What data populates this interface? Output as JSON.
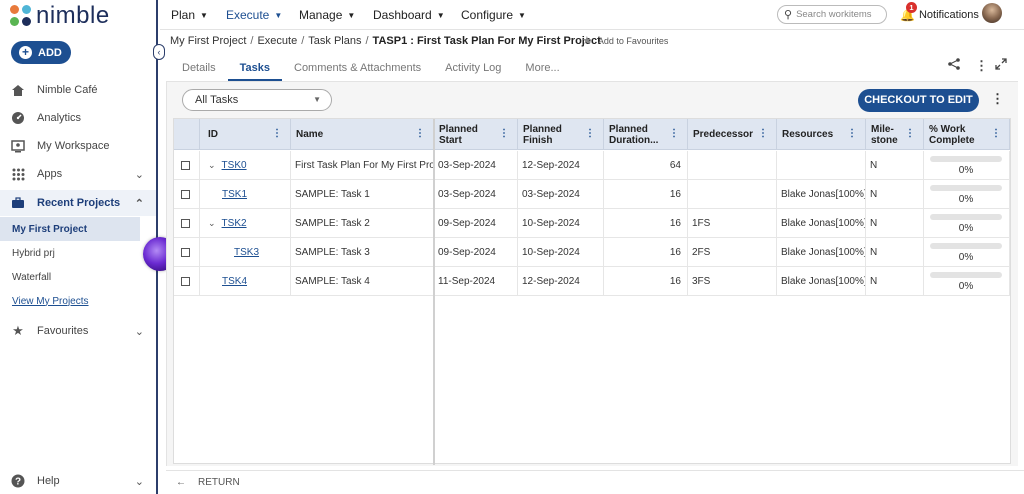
{
  "brand": {
    "name": "nimble"
  },
  "sidebar": {
    "add_label": "ADD",
    "items": [
      {
        "label": "Nimble Café",
        "icon": "home-icon"
      },
      {
        "label": "Analytics",
        "icon": "speedometer-icon"
      },
      {
        "label": "My Workspace",
        "icon": "workspace-icon"
      },
      {
        "label": "Apps",
        "icon": "apps-grid-icon"
      },
      {
        "label": "Recent Projects",
        "icon": "briefcase-icon"
      },
      {
        "label": "Favourites",
        "icon": "star-icon"
      },
      {
        "label": "Help",
        "icon": "help-icon"
      }
    ],
    "recent_projects": [
      "My First Project",
      "Hybrid prj",
      "Waterfall"
    ],
    "view_projects_label": "View My Projects"
  },
  "topnav": {
    "menus": [
      "Plan",
      "Execute",
      "Manage",
      "Dashboard",
      "Configure"
    ],
    "active_menu": "Execute",
    "search_placeholder": "Search workitems",
    "notifications_label": "Notifications",
    "notification_count": "1"
  },
  "breadcrumb": {
    "items": [
      "My First Project",
      "Execute",
      "Task Plans"
    ],
    "current": "TASP1 : First Task Plan For My First Project",
    "favourite_label": "Add to Favourites"
  },
  "tabs": [
    "Details",
    "Tasks",
    "Comments & Attachments",
    "Activity Log",
    "More..."
  ],
  "active_tab": "Tasks",
  "toolbar": {
    "filter_value": "All Tasks",
    "checkout_label": "CHECKOUT TO EDIT"
  },
  "grid": {
    "columns": [
      "ID",
      "Name",
      "Planned Start",
      "Planned Finish",
      "Planned Duration...",
      "Predecessor",
      "Resources",
      "Mile-stone",
      "% Work Complete"
    ],
    "rows": [
      {
        "id": "TSK0",
        "expand": true,
        "indent": 0,
        "name": "First Task Plan For My First Project",
        "start": "03-Sep-2024",
        "finish": "12-Sep-2024",
        "duration": "64",
        "predecessor": "",
        "resources": "",
        "milestone": "N",
        "progress": "0%"
      },
      {
        "id": "TSK1",
        "expand": false,
        "indent": 1,
        "name": "SAMPLE: Task 1",
        "start": "03-Sep-2024",
        "finish": "03-Sep-2024",
        "duration": "16",
        "predecessor": "",
        "resources": "Blake Jonas[100%]",
        "milestone": "N",
        "progress": "0%"
      },
      {
        "id": "TSK2",
        "expand": true,
        "indent": 0,
        "name": "SAMPLE: Task 2",
        "start": "09-Sep-2024",
        "finish": "10-Sep-2024",
        "duration": "16",
        "predecessor": "1FS",
        "resources": "Blake Jonas[100%]",
        "milestone": "N",
        "progress": "0%"
      },
      {
        "id": "TSK3",
        "expand": false,
        "indent": 2,
        "name": "SAMPLE: Task 3",
        "start": "09-Sep-2024",
        "finish": "10-Sep-2024",
        "duration": "16",
        "predecessor": "2FS",
        "resources": "Blake Jonas[100%]",
        "milestone": "N",
        "progress": "0%"
      },
      {
        "id": "TSK4",
        "expand": false,
        "indent": 1,
        "name": "SAMPLE: Task 4",
        "start": "11-Sep-2024",
        "finish": "12-Sep-2024",
        "duration": "16",
        "predecessor": "3FS",
        "resources": "Blake Jonas[100%]",
        "milestone": "N",
        "progress": "0%"
      }
    ]
  },
  "footer": {
    "return_label": "RETURN"
  }
}
